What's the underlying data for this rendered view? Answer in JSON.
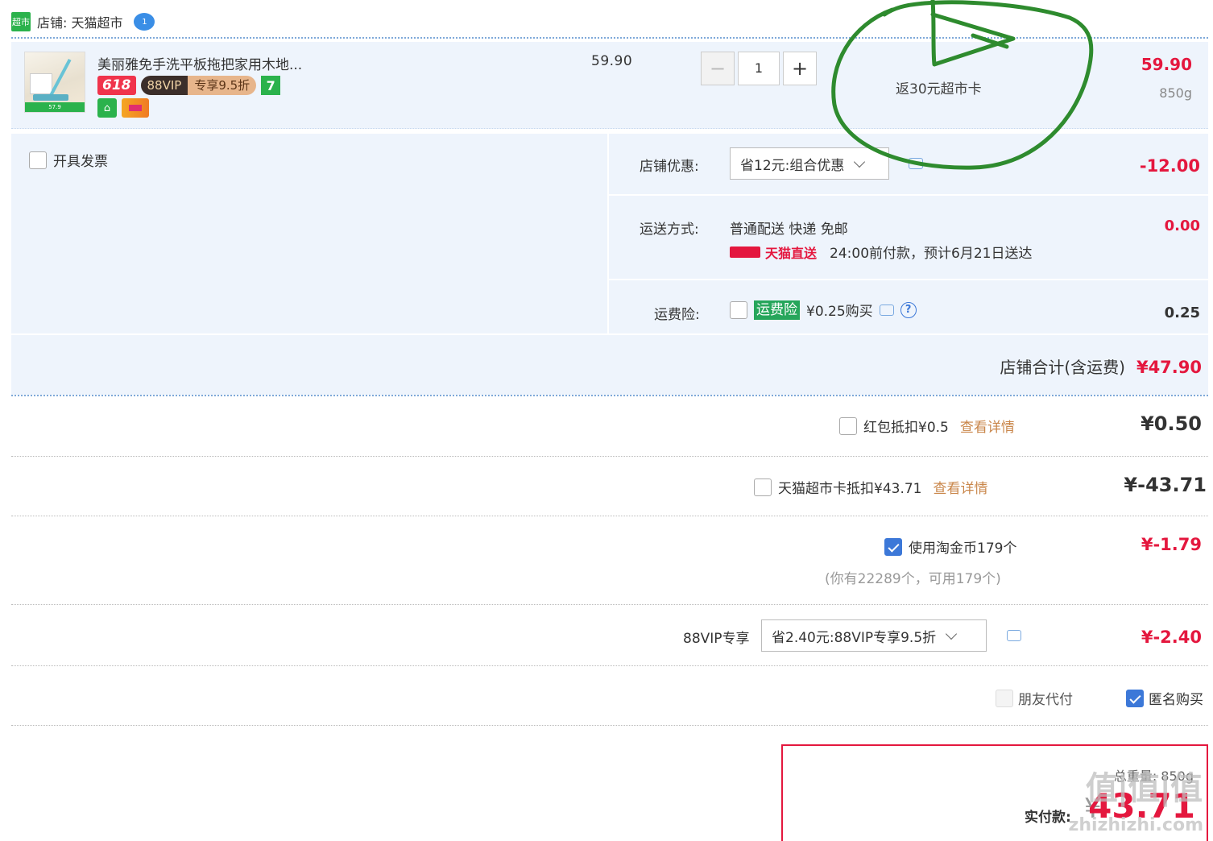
{
  "store": {
    "badge": "超市",
    "name": "店铺: 天猫超市",
    "ww_badge": "1"
  },
  "item": {
    "title": "美丽雅免手洗平板拖把家用木地...",
    "tag_618": "618",
    "tag_vip_left": "88VIP",
    "tag_vip_right": "专享9.5折",
    "tag_7": "7",
    "unit_price": "59.90",
    "qty_minus": "−",
    "qty": "1",
    "qty_plus": "+",
    "rebate": "返30元超市卡",
    "total": "59.90",
    "weight": "850g",
    "thumb_price": "57.9"
  },
  "invoice": {
    "label": "开具发票"
  },
  "store_discount": {
    "label": "店铺优惠:",
    "option": "省12元:组合优惠",
    "amount": "-12.00"
  },
  "shipping": {
    "label": "运送方式:",
    "method": "普通配送 快递 免邮",
    "tmall_tag": "天猫直送",
    "eta": "24:00前付款，预计6月21日送达",
    "amount": "0.00"
  },
  "insurance": {
    "label": "运费险:",
    "tag": "运费险",
    "price": "¥0.25购买",
    "help": "?",
    "amount": "0.25"
  },
  "store_total": {
    "label": "店铺合计(含运费)",
    "value": "¥47.90"
  },
  "redpacket": {
    "label": "红包抵扣¥0.5",
    "link": "查看详情",
    "amount": "¥0.50"
  },
  "supermarket_card": {
    "label": "天猫超市卡抵扣¥43.71",
    "link": "查看详情",
    "amount": "¥-43.71"
  },
  "taojinbi": {
    "label": "使用淘金币179个",
    "note": "(你有22289个，可用179个)",
    "amount": "¥-1.79"
  },
  "vip": {
    "label": "88VIP专享",
    "option": "省2.40元:88VIP专享9.5折",
    "amount": "¥-2.40"
  },
  "friend_pay": {
    "label": "朋友代付"
  },
  "anonymous": {
    "label": "匿名购买"
  },
  "pay": {
    "weight": "总重量: 850g",
    "label": "实付款:",
    "currency": "¥",
    "amount": "43.71"
  },
  "watermark": {
    "big": "值|值|值",
    "small": "zhizhizhi.com"
  },
  "colors": {
    "accent": "#e4173e",
    "panel": "#eef4fc",
    "link": "#c9864a",
    "annotation": "#2e8b2e"
  }
}
